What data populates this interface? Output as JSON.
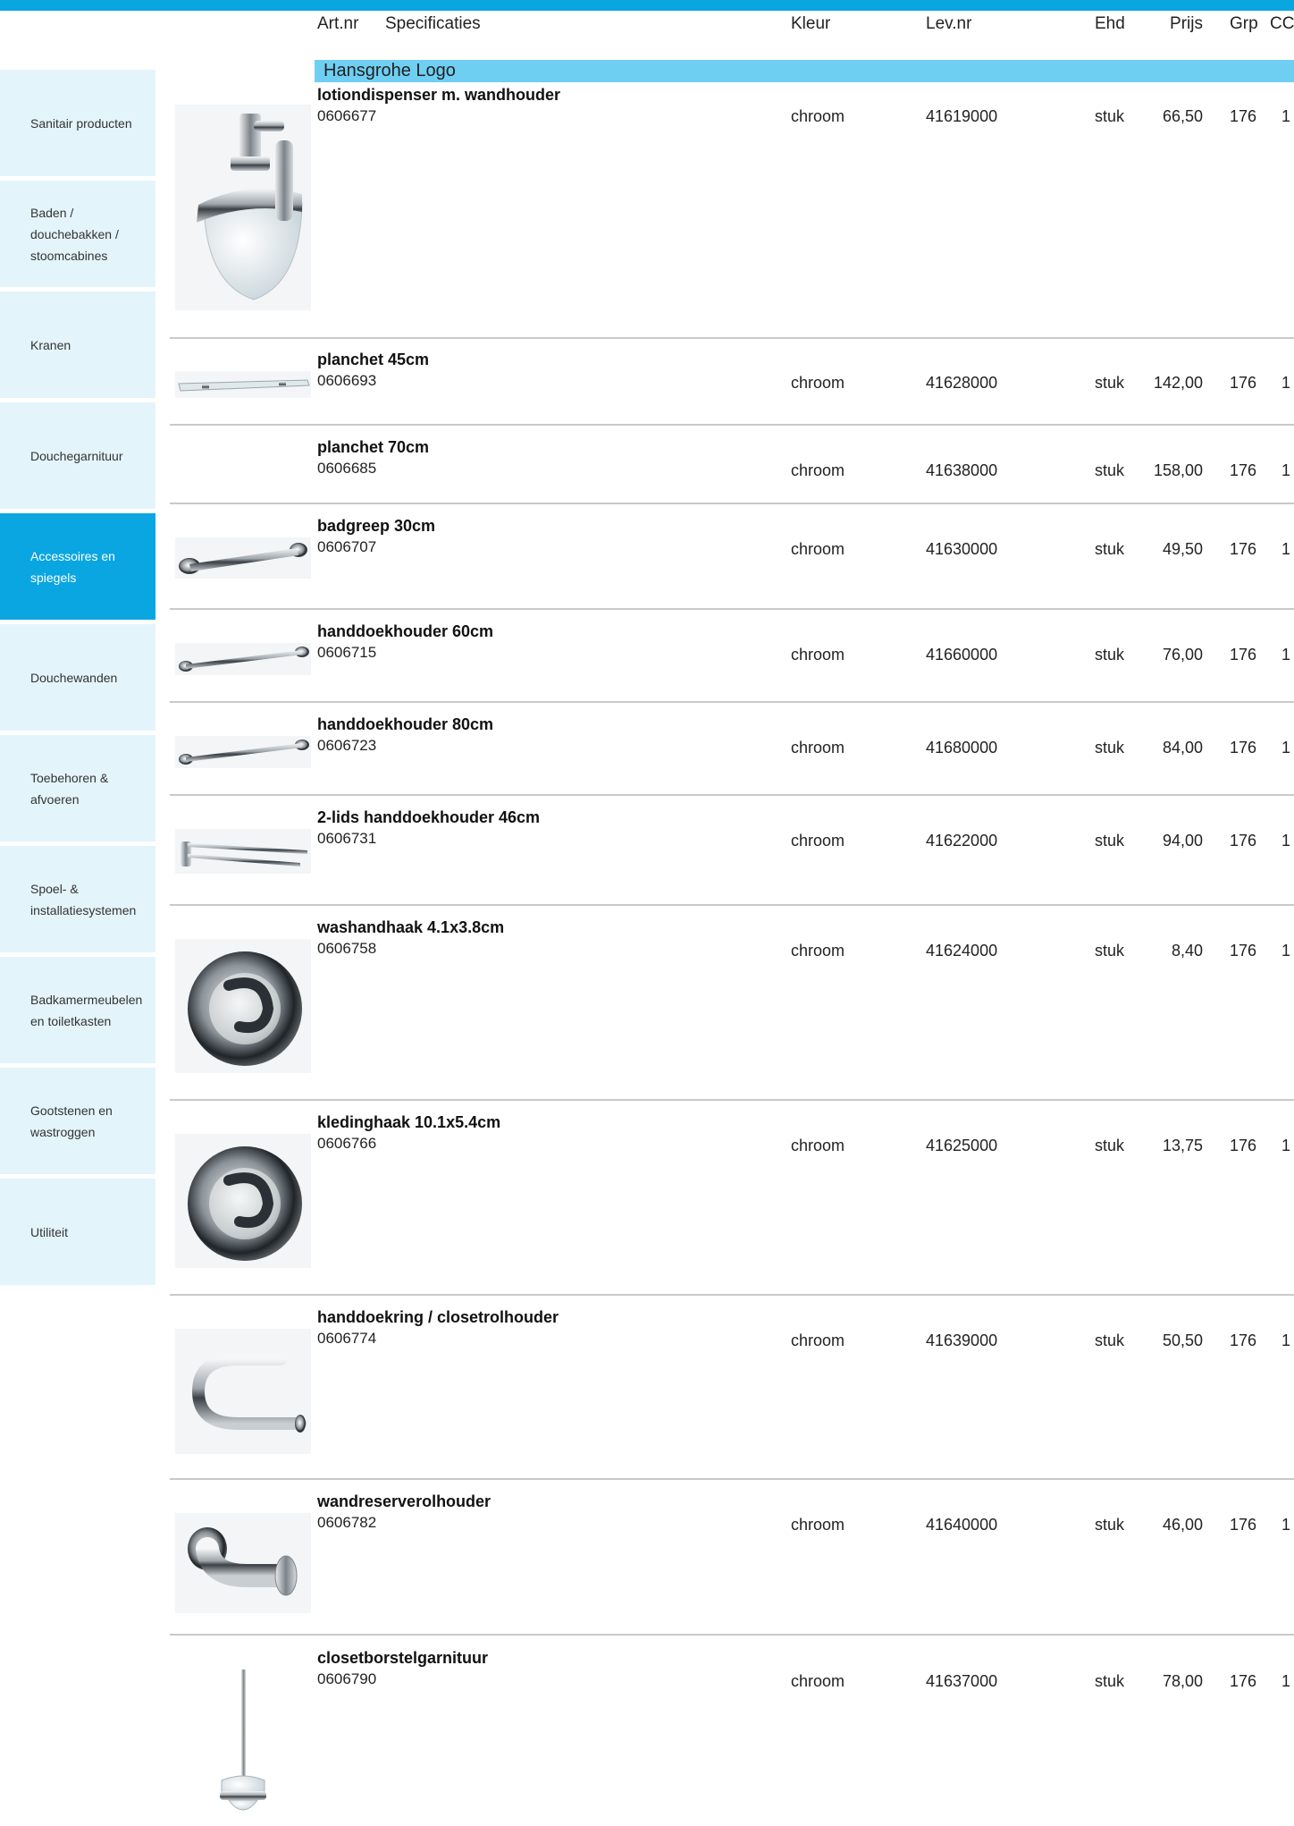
{
  "header": {
    "columns": {
      "artnr": "Art.nr",
      "spec": "Specificaties",
      "kleur": "Kleur",
      "levnr": "Lev.nr",
      "ehd": "Ehd",
      "prijs": "Prijs",
      "grp": "Grp",
      "cc": "CC"
    },
    "group": "Hansgrohe Logo"
  },
  "sidebar": {
    "items": [
      {
        "label": "Sanitair producten"
      },
      {
        "label": "Baden / douchebakken / stoomcabines"
      },
      {
        "label": "Kranen"
      },
      {
        "label": "Douchegarnituur"
      },
      {
        "label": "Accessoires en spiegels",
        "active": true
      },
      {
        "label": "Douchewanden"
      },
      {
        "label": "Toebehoren & afvoeren"
      },
      {
        "label": "Spoel- & installatiesystemen"
      },
      {
        "label": "Badkamermeubelen en toiletkasten"
      },
      {
        "label": "Gootstenen en wastroggen"
      },
      {
        "label": "Utiliteit"
      }
    ]
  },
  "products": [
    {
      "name": "lotiondispenser m. wandhouder",
      "code": "0606677",
      "kleur": "chroom",
      "levnr": "41619000",
      "ehd": "stuk",
      "prijs": "66,50",
      "grp": "176",
      "cc": "1",
      "image": "lotion-dispenser-icon"
    },
    {
      "name": "planchet 45cm",
      "code": "0606693",
      "kleur": "chroom",
      "levnr": "41628000",
      "ehd": "stuk",
      "prijs": "142,00",
      "grp": "176",
      "cc": "1",
      "image": "glass-shelf-icon"
    },
    {
      "name": "planchet 70cm",
      "code": "0606685",
      "kleur": "chroom",
      "levnr": "41638000",
      "ehd": "stuk",
      "prijs": "158,00",
      "grp": "176",
      "cc": "1",
      "image": ""
    },
    {
      "name": "badgreep 30cm",
      "code": "0606707",
      "kleur": "chroom",
      "levnr": "41630000",
      "ehd": "stuk",
      "prijs": "49,50",
      "grp": "176",
      "cc": "1",
      "image": "grab-bar-icon"
    },
    {
      "name": "handdoekhouder 60cm",
      "code": "0606715",
      "kleur": "chroom",
      "levnr": "41660000",
      "ehd": "stuk",
      "prijs": "76,00",
      "grp": "176",
      "cc": "1",
      "image": "towel-rail-icon"
    },
    {
      "name": "handdoekhouder 80cm",
      "code": "0606723",
      "kleur": "chroom",
      "levnr": "41680000",
      "ehd": "stuk",
      "prijs": "84,00",
      "grp": "176",
      "cc": "1",
      "image": "towel-rail-icon"
    },
    {
      "name": "2-lids handdoekhouder 46cm",
      "code": "0606731",
      "kleur": "chroom",
      "levnr": "41622000",
      "ehd": "stuk",
      "prijs": "94,00",
      "grp": "176",
      "cc": "1",
      "image": "double-towel-bar-icon"
    },
    {
      "name": "washandhaak 4.1x3.8cm",
      "code": "0606758",
      "kleur": "chroom",
      "levnr": "41624000",
      "ehd": "stuk",
      "prijs": "8,40",
      "grp": "176",
      "cc": "1",
      "image": "round-hook-icon"
    },
    {
      "name": "kledinghaak 10.1x5.4cm",
      "code": "0606766",
      "kleur": "chroom",
      "levnr": "41625000",
      "ehd": "stuk",
      "prijs": "13,75",
      "grp": "176",
      "cc": "1",
      "image": "round-hook-icon"
    },
    {
      "name": "handdoekring / closetrolhouder",
      "code": "0606774",
      "kleur": "chroom",
      "levnr": "41639000",
      "ehd": "stuk",
      "prijs": "50,50",
      "grp": "176",
      "cc": "1",
      "image": "towel-ring-icon"
    },
    {
      "name": "wandreserverolhouder",
      "code": "0606782",
      "kleur": "chroom",
      "levnr": "41640000",
      "ehd": "stuk",
      "prijs": "46,00",
      "grp": "176",
      "cc": "1",
      "image": "spare-roll-holder-icon"
    },
    {
      "name": "closetborstelgarnituur",
      "code": "0606790",
      "kleur": "chroom",
      "levnr": "41637000",
      "ehd": "stuk",
      "prijs": "78,00",
      "grp": "176",
      "cc": "1",
      "image": "toilet-brush-icon"
    }
  ],
  "colors": {
    "accent": "#0aa6e2",
    "band": "#6fcff3",
    "sidebar": "#e4f4fb"
  }
}
